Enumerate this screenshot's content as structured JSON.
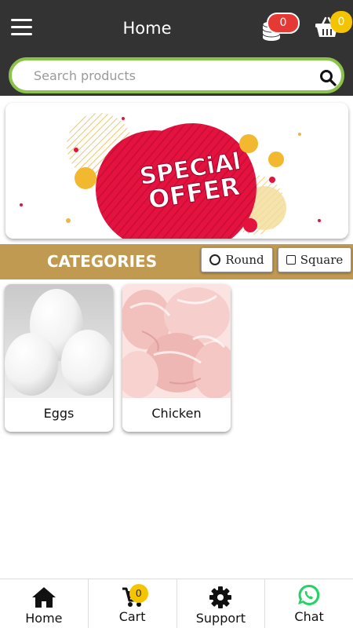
{
  "header": {
    "title": "Home",
    "coins_count": "0",
    "basket_count": "0"
  },
  "search": {
    "placeholder": "Search products"
  },
  "banner": {
    "text_line1": "SPECiAl",
    "text_line2": "OFFER"
  },
  "categories": {
    "title": "CATEGORIES",
    "round_label": "Round",
    "square_label": "Square",
    "items": [
      {
        "label": "Eggs"
      },
      {
        "label": "Chicken"
      }
    ]
  },
  "bottom_nav": {
    "items": [
      {
        "label": "Home",
        "icon": "home-icon"
      },
      {
        "label": "Cart",
        "icon": "cart-icon",
        "badge": "0"
      },
      {
        "label": "Support",
        "icon": "gear-icon"
      },
      {
        "label": "Chat",
        "icon": "whatsapp-icon"
      }
    ]
  },
  "colors": {
    "header_bg": "#333333",
    "search_border": "#8bc34a",
    "categories_bar": "#c19a52",
    "badge_red": "#e53935",
    "badge_yellow": "#f5c400",
    "whatsapp_green": "#25d366"
  }
}
